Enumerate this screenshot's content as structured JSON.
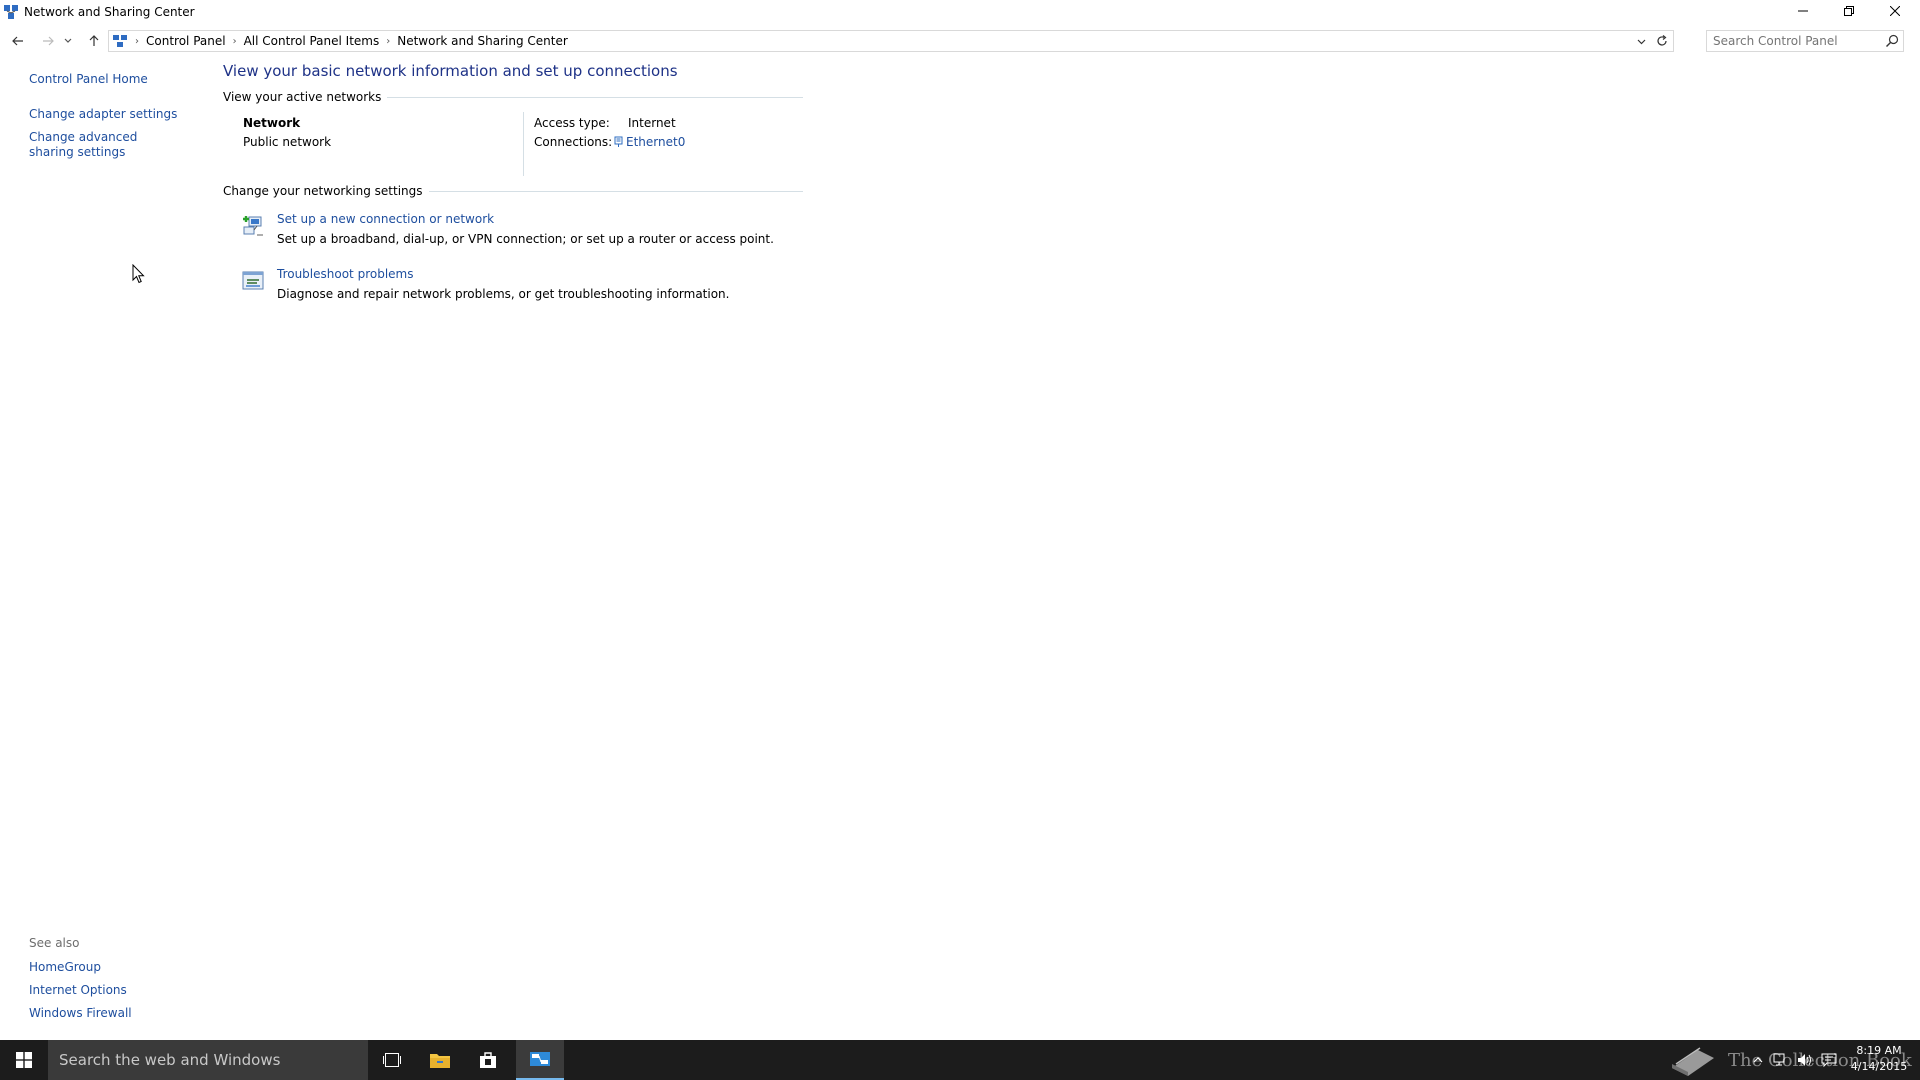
{
  "window": {
    "title": "Network and Sharing Center",
    "icon": "network-sharing-icon"
  },
  "address": {
    "crumbs": [
      "Control Panel",
      "All Control Panel Items",
      "Network and Sharing Center"
    ],
    "search_placeholder": "Search Control Panel"
  },
  "leftpane": {
    "home": "Control Panel Home",
    "adapter": "Change adapter settings",
    "advanced": "Change advanced sharing settings"
  },
  "seealso": {
    "header": "See also",
    "items": [
      "HomeGroup",
      "Internet Options",
      "Windows Firewall"
    ]
  },
  "main": {
    "title": "View your basic network information and set up connections",
    "active_header": "View your active networks",
    "network_name": "Network",
    "network_type": "Public network",
    "access_label": "Access type:",
    "access_value": "Internet",
    "connections_label": "Connections:",
    "connections_value": "Ethernet0",
    "change_header": "Change your networking settings",
    "tasks": [
      {
        "link": "Set up a new connection or network",
        "desc": "Set up a broadband, dial-up, or VPN connection; or set up a router or access point.",
        "icon": "new-connection-icon"
      },
      {
        "link": "Troubleshoot problems",
        "desc": "Diagnose and repair network problems, or get troubleshooting information.",
        "icon": "troubleshoot-icon"
      }
    ]
  },
  "taskbar": {
    "search_text": "Search the web and Windows",
    "watermark": "The Collection Book",
    "time": "8:19 AM",
    "date": "4/14/2015"
  },
  "colors": {
    "link": "#1e4e9e",
    "title": "#1e3287",
    "taskbar": "#1c1c1c",
    "taskbar_accent": "#76b9ed"
  }
}
